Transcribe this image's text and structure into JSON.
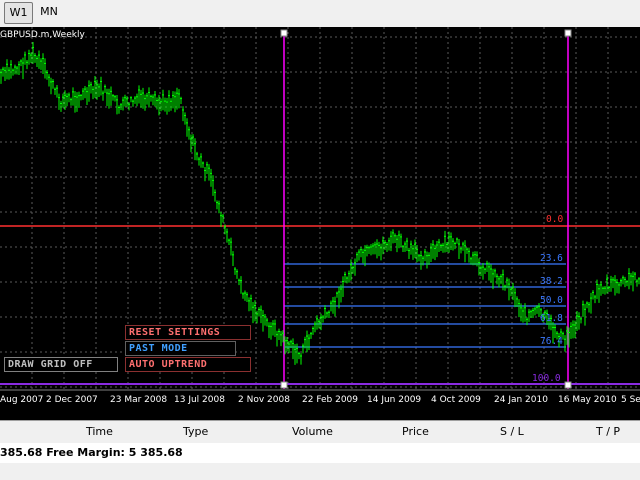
{
  "toolbar": {
    "tf_w1": "W1",
    "tf_mn": "MN"
  },
  "chart": {
    "symbol_title": "GBPUSD.m,Weekly",
    "fib_levels": [
      {
        "label": "0.0",
        "color": "#ff3030"
      },
      {
        "label": "23.6",
        "color": "#3a78ff"
      },
      {
        "label": "38.2",
        "color": "#3a78ff"
      },
      {
        "label": "50.0",
        "color": "#3a78ff"
      },
      {
        "label": "61.8",
        "color": "#3a78ff"
      },
      {
        "label": "76.4",
        "color": "#3a78ff"
      },
      {
        "label": "100.0",
        "color": "#8a2be2"
      }
    ],
    "x_ticks": [
      "Aug 2007",
      "2 Dec 2007",
      "23 Mar 2008",
      "13 Jul 2008",
      "2 Nov 2008",
      "22 Feb 2009",
      "14 Jun 2009",
      "4 Oct 2009",
      "24 Jan 2010",
      "16 May 2010",
      "5 Se"
    ],
    "colors": {
      "candles": "#00ff00",
      "grid": "#5a5a5a",
      "fib_line": "#3a78ff",
      "zero_line": "#ff3030",
      "hundred_line": "#8a2be2",
      "selector": "#ff00ff"
    }
  },
  "controls": {
    "reset_settings": "RESET SETTINGS",
    "past_mode": "PAST MODE",
    "auto_uptrend": "AUTO UPTREND",
    "draw_grid_off": "DRAW GRID OFF"
  },
  "terminal": {
    "columns": [
      "Time",
      "Type",
      "Volume",
      "Price",
      "S / L",
      "T / P"
    ],
    "status_text": "385.68  Free Margin: 5 385.68"
  }
}
